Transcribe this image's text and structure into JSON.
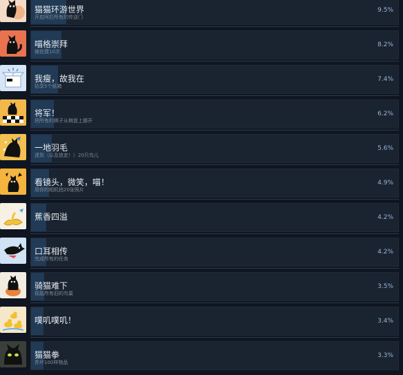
{
  "achievements": [
    {
      "title": "猫猫环游世界",
      "desc": "开启阿匹所有的传送门",
      "percent_label": "9.5%",
      "percent": 9.5,
      "icon": "cat-globe-icon"
    },
    {
      "title": "喵格崇拜",
      "desc": "被抚摸10次",
      "percent_label": "8.2%",
      "percent": 8.2,
      "icon": "cat-red-icon"
    },
    {
      "title": "我瘦，故我在",
      "desc": "钻享5个纸箱",
      "percent_label": "7.4%",
      "percent": 7.4,
      "icon": "cardboard-box-icon"
    },
    {
      "title": "将军！",
      "desc": "把所有的棋子从棋盘上挪开",
      "percent_label": "6.2%",
      "percent": 6.2,
      "icon": "chess-icon"
    },
    {
      "title": "一地羽毛",
      "desc": "逮到（以及放走！）20只鸟儿",
      "percent_label": "5.6%",
      "percent": 5.6,
      "icon": "cat-bird-icon"
    },
    {
      "title": "看镜头，微笑，喵！",
      "desc": "用你的相机拍20张照片",
      "percent_label": "4.9%",
      "percent": 4.9,
      "icon": "cat-camera-icon"
    },
    {
      "title": "蕉香四溢",
      "desc": "",
      "percent_label": "4.2%",
      "percent": 4.2,
      "icon": "banana-peel-icon"
    },
    {
      "title": "口耳相传",
      "desc": "完成所有的任务",
      "percent_label": "4.2%",
      "percent": 4.2,
      "icon": "cat-flying-icon"
    },
    {
      "title": "骑猫难下",
      "desc": "摇匙所有旧的鸟巢",
      "percent_label": "3.5%",
      "percent": 3.5,
      "icon": "cat-nest-icon"
    },
    {
      "title": "噗叽噗叽！",
      "desc": "",
      "percent_label": "3.4%",
      "percent": 3.4,
      "icon": "rubber-ducks-icon"
    },
    {
      "title": "猫猫拳",
      "desc": "弄坏100样物品",
      "percent_label": "3.3%",
      "percent": 3.3,
      "icon": "cat-shadow-icon"
    }
  ],
  "colors": {
    "background": "#0f1622",
    "panel": "#1a2330",
    "progress_fill": "#213a55",
    "percent_text": "#9ab6d6"
  }
}
